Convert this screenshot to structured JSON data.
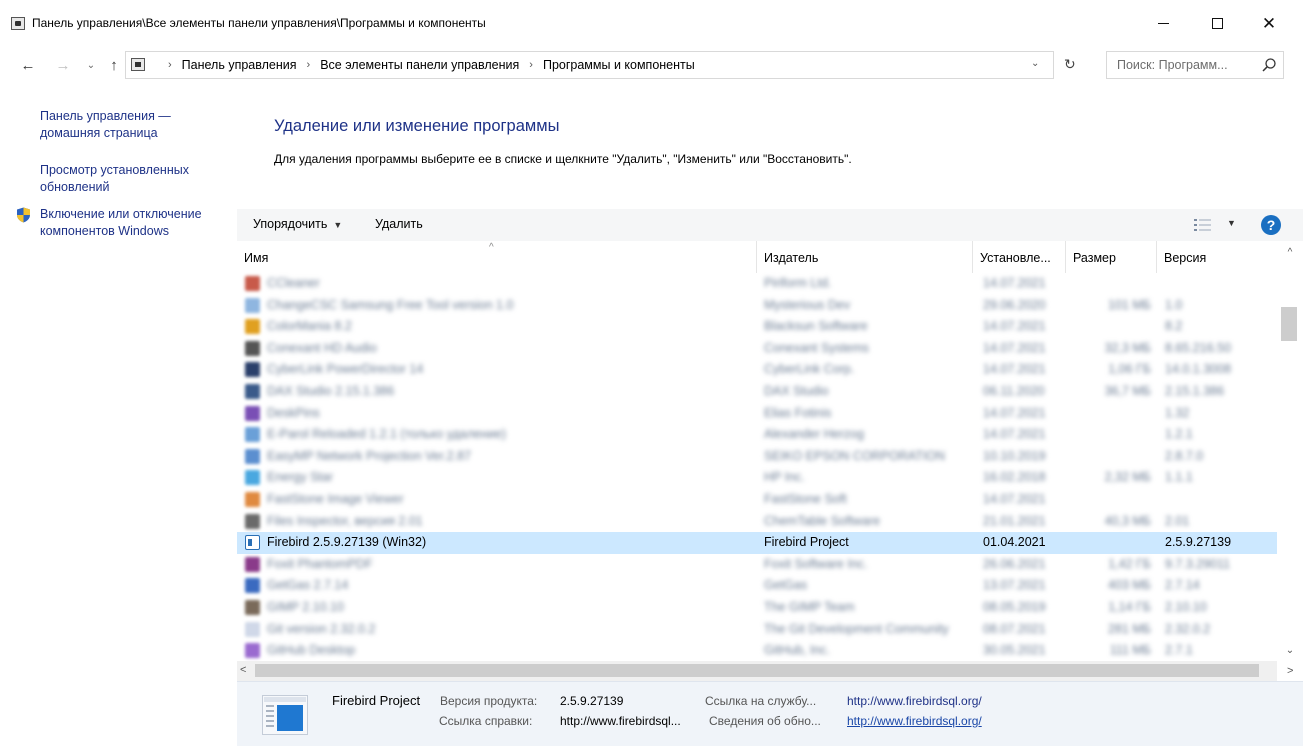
{
  "window": {
    "title": "Панель управления\\Все элементы панели управления\\Программы и компоненты",
    "minimize_glyph": "",
    "close_glyph": "✕"
  },
  "nav": {
    "back": "←",
    "forward": "→",
    "recent": "⌄",
    "up": "↑",
    "breadcrumbs": [
      "Панель управления",
      "Все элементы панели управления",
      "Программы и компоненты"
    ],
    "separator": "›",
    "dropdown": "⌄",
    "refresh": "↻",
    "search_placeholder": "Поиск: Программ..."
  },
  "sidebar": {
    "links": [
      "Панель управления — домашняя страница",
      "Просмотр установленных обновлений",
      "Включение или отключение компонентов Windows"
    ]
  },
  "content": {
    "title": "Удаление или изменение программы",
    "description": "Для удаления программы выберите ее в списке и щелкните \"Удалить\", \"Изменить\" или \"Восстановить\"."
  },
  "toolbar": {
    "organize": "Упорядочить",
    "organize_caret": "▼",
    "uninstall": "Удалить",
    "view_caret": "▼",
    "help": "?"
  },
  "columns": {
    "name": "Имя",
    "publisher": "Издатель",
    "installed": "Установле...",
    "size": "Размер",
    "version": "Версия",
    "sort_arrow": "^"
  },
  "rows": [
    {
      "name": "CCleaner",
      "publisher": "Piriform Ltd.",
      "date": "14.07.2021",
      "size": "",
      "version": "",
      "icon_color": "#c85a4a",
      "blurred": true
    },
    {
      "name": "ChangeCSC Samsung Free Tool version 1.0",
      "publisher": "Mysterious Dev",
      "date": "29.06.2020",
      "size": "101 МБ",
      "version": "1.0",
      "icon_color": "#8fb6e0",
      "blurred": true
    },
    {
      "name": "ColorMania 8.2",
      "publisher": "Blacksun Software",
      "date": "14.07.2021",
      "size": "",
      "version": "8.2",
      "icon_color": "#e0a020",
      "blurred": true
    },
    {
      "name": "Conexant HD Audio",
      "publisher": "Conexant Systems",
      "date": "14.07.2021",
      "size": "32,3 МБ",
      "version": "8.65.216.50",
      "icon_color": "#555555",
      "blurred": true
    },
    {
      "name": "CyberLink PowerDirector 14",
      "publisher": "CyberLink Corp.",
      "date": "14.07.2021",
      "size": "1,06 ГБ",
      "version": "14.0.1.3008",
      "icon_color": "#2a3f6a",
      "blurred": true
    },
    {
      "name": "DAX Studio 2.15.1.386",
      "publisher": "DAX Studio",
      "date": "06.11.2020",
      "size": "36,7 МБ",
      "version": "2.15.1.386",
      "icon_color": "#3a5a8a",
      "blurred": true
    },
    {
      "name": "DeskPins",
      "publisher": "Elias Fotinis",
      "date": "14.07.2021",
      "size": "",
      "version": "1.32",
      "icon_color": "#7a4fb5",
      "blurred": true
    },
    {
      "name": "E-Parol Reloaded 1.2.1 (только удаление)",
      "publisher": "Alexander Herzog",
      "date": "14.07.2021",
      "size": "",
      "version": "1.2.1",
      "icon_color": "#6aa0d8",
      "blurred": true
    },
    {
      "name": "EasyMP Network Projection Ver.2.87",
      "publisher": "SEIKO EPSON CORPORATION",
      "date": "10.10.2019",
      "size": "",
      "version": "2.8.7.0",
      "icon_color": "#5b8fd0",
      "blurred": true
    },
    {
      "name": "Energy Star",
      "publisher": "HP Inc.",
      "date": "16.02.2018",
      "size": "2,32 МБ",
      "version": "1.1.1",
      "icon_color": "#4aa8e0",
      "blurred": true
    },
    {
      "name": "FastStone Image Viewer",
      "publisher": "FastStone Soft",
      "date": "14.07.2021",
      "size": "",
      "version": "",
      "icon_color": "#e08a40",
      "blurred": true
    },
    {
      "name": "Files Inspector, версия 2.01",
      "publisher": "ChemTable Software",
      "date": "21.01.2021",
      "size": "40,3 МБ",
      "version": "2.01",
      "icon_color": "#6a6a6a",
      "blurred": true
    },
    {
      "name": "Firebird 2.5.9.27139 (Win32)",
      "publisher": "Firebird Project",
      "date": "01.04.2021",
      "size": "",
      "version": "2.5.9.27139",
      "icon_color": "#2a6fb5",
      "blurred": false
    },
    {
      "name": "Foxit PhantomPDF",
      "publisher": "Foxit Software Inc.",
      "date": "26.06.2021",
      "size": "1,42 ГБ",
      "version": "9.7.3.29011",
      "icon_color": "#8a3a8a",
      "blurred": true
    },
    {
      "name": "GetGas 2.7.14",
      "publisher": "GetGas",
      "date": "13.07.2021",
      "size": "403 МБ",
      "version": "2.7.14",
      "icon_color": "#3a6ac0",
      "blurred": true
    },
    {
      "name": "GIMP 2.10.10",
      "publisher": "The GIMP Team",
      "date": "08.05.2019",
      "size": "1,14 ГБ",
      "version": "2.10.10",
      "icon_color": "#7a6a5a",
      "blurred": true
    },
    {
      "name": "Git version 2.32.0.2",
      "publisher": "The Git Development Community",
      "date": "08.07.2021",
      "size": "281 МБ",
      "version": "2.32.0.2",
      "icon_color": "#d0d8e8",
      "blurred": true
    },
    {
      "name": "GitHub Desktop",
      "publisher": "GitHub, Inc.",
      "date": "30.05.2021",
      "size": "111 МБ",
      "version": "2.7.1",
      "icon_color": "#9a6ad0",
      "blurred": true
    }
  ],
  "scroll": {
    "up": "^",
    "down": "⌄",
    "left": "<",
    "right": ">"
  },
  "details": {
    "publisher": "Firebird Project",
    "version_label": "Версия продукта:",
    "version_value": "2.5.9.27139",
    "support_label": "Ссылка на службу...",
    "support_value": "http://www.firebirdsql.org/",
    "help_label": "Ссылка справки:",
    "help_value": "http://www.firebirdsql...",
    "update_label": "Сведения об обно...",
    "update_value": "http://www.firebirdsql.org/"
  },
  "colors": {
    "accent_link": "#1e3287",
    "selection": "#cce8ff",
    "details_bg": "#f0f4f9"
  }
}
